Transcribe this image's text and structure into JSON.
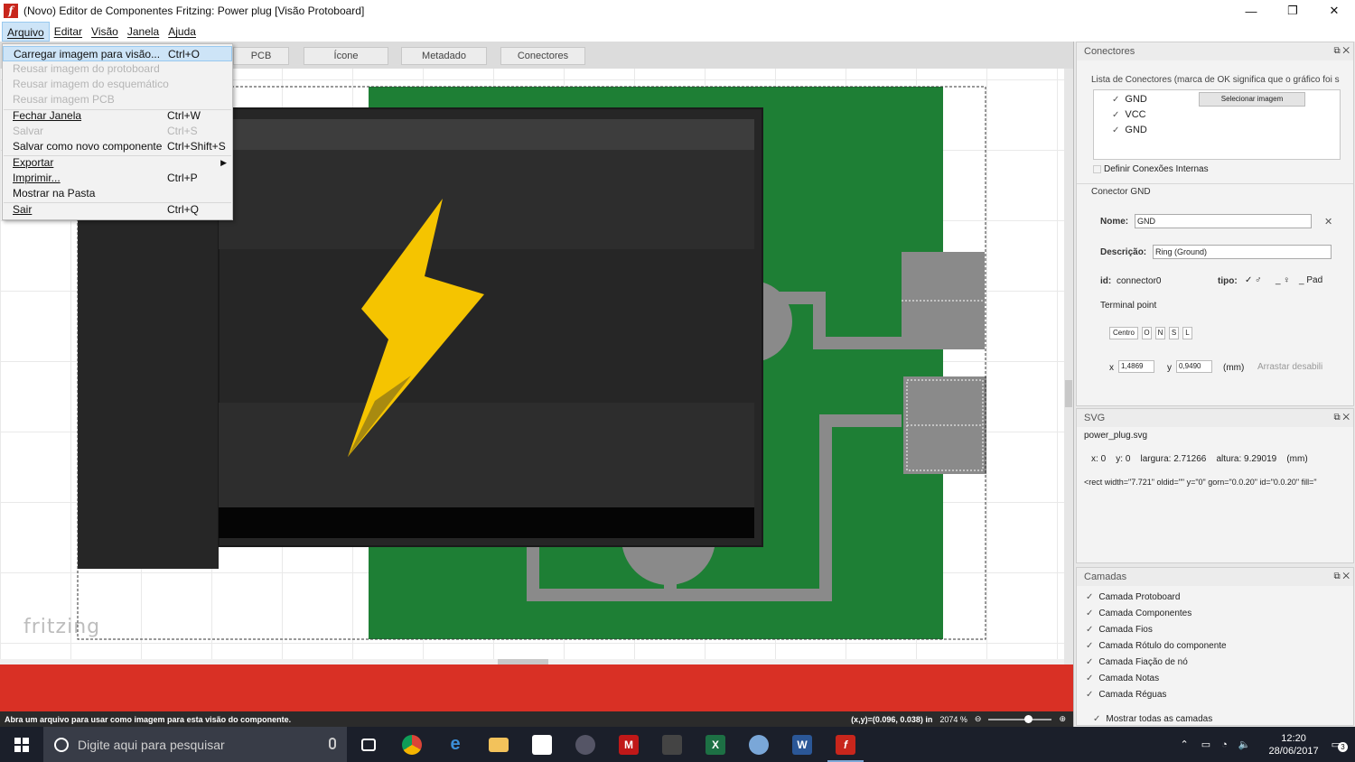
{
  "window": {
    "app_icon": "f",
    "title": "(Novo) Editor de Componentes Fritzing: Power plug [Visão Protoboard]",
    "minimize": "—",
    "maximize": "❐",
    "close": "✕"
  },
  "menubar": {
    "items": [
      "Arquivo",
      "Editar",
      "Visão",
      "Janela",
      "Ajuda"
    ]
  },
  "tabs": {
    "pcb": "PCB",
    "icone": "Ícone",
    "metadado": "Metadado",
    "conectores": "Conectores"
  },
  "file_menu": {
    "items": [
      {
        "label": "Carregar imagem para visão...",
        "shortcut": "Ctrl+O"
      },
      {
        "label": "Reusar imagem do protoboard",
        "shortcut": ""
      },
      {
        "label": "Reusar imagem do esquemático",
        "shortcut": ""
      },
      {
        "label": "Reusar imagem PCB",
        "shortcut": ""
      },
      {
        "label": "Fechar Janela",
        "shortcut": "Ctrl+W"
      },
      {
        "label": "Salvar",
        "shortcut": "Ctrl+S"
      },
      {
        "label": "Salvar como novo componente",
        "shortcut": "Ctrl+Shift+S"
      },
      {
        "label": "Exportar",
        "shortcut": ""
      },
      {
        "label": "Imprimir...",
        "shortcut": "Ctrl+P"
      },
      {
        "label": "Mostrar na Pasta",
        "shortcut": ""
      },
      {
        "label": "Sair",
        "shortcut": "Ctrl+Q"
      }
    ]
  },
  "canvas": {
    "logo": "fritzing",
    "colors": {
      "pcb_green": "#1e7f35",
      "plug_dark": "#262626",
      "pad_grey": "#8a8a8a",
      "bolt_yellow": "#f5c400"
    }
  },
  "statusbar": {
    "message": "Abra um arquivo para usar como imagem para esta visão do componente.",
    "coords": "(x,y)=(0.096, 0.038) in",
    "zoom": "2074 %",
    "zoom_out": "⊖",
    "zoom_in": "⊕"
  },
  "connectors_panel": {
    "title": "Conectores",
    "list_label": "Lista de Conectores (marca de OK significa que o gráfico foi s",
    "connectors": [
      "GND",
      "VCC",
      "GND"
    ],
    "select_image_button": "Selecionar imagem",
    "internal_connections": "Definir Conexões Internas",
    "section_title": "Conector GND",
    "name_label": "Nome:",
    "name_value": "GND",
    "description_label": "Descrição:",
    "description_value": "Ring (Ground)",
    "id_label": "id:",
    "id_value": "connector0",
    "type_label": "tipo:",
    "type_male": "♂",
    "type_female": "♀",
    "type_pad": "Pad",
    "terminal_label": "Terminal point",
    "terminal_buttons": [
      "Centro",
      "O",
      "N",
      "S",
      "L"
    ],
    "x_label": "x",
    "x_value": "1,4869",
    "y_label": "y",
    "y_value": "0,9490",
    "unit": "(mm)",
    "drag_label": "Arrastar desabili"
  },
  "svg_panel": {
    "title": "SVG",
    "filename": "power_plug.svg",
    "x_label": "x:",
    "x_value": "0",
    "y_label": "y:",
    "y_value": "0",
    "width_label": "largura:",
    "width_value": "2.71266",
    "height_label": "altura:",
    "height_value": "9.29019",
    "unit": "(mm)",
    "element": "<rect width=\"7.721\" oldid=\"\" y=\"0\" gorn=\"0.0.20\" id=\"0.0.20\" fill=\""
  },
  "layers_panel": {
    "title": "Camadas",
    "layers": [
      "Camada Protoboard",
      "Camada Componentes",
      "Camada Fios",
      "Camada Rótulo do componente",
      "Camada Fiação de nó",
      "Camada Notas",
      "Camada Réguas"
    ],
    "show_all": "Mostrar todas as camadas"
  },
  "taskbar": {
    "search_placeholder": "Digite aqui para pesquisar",
    "time": "12:20",
    "date": "28/06/2017",
    "notifications": "3"
  }
}
